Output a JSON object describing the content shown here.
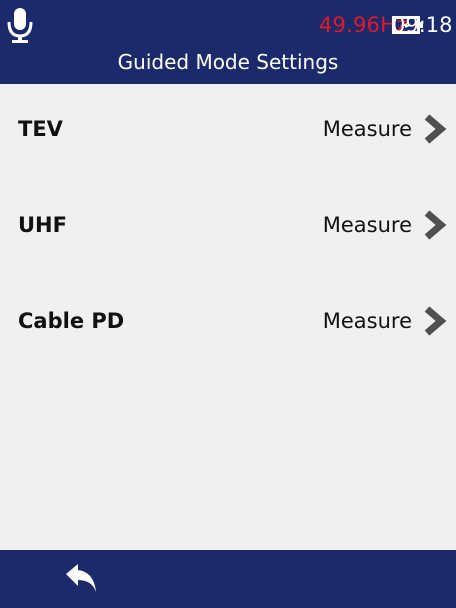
{
  "header": {
    "mic_icon": "microphone-icon",
    "frequency": "49.96Hz",
    "frequency_color": "#e0192a",
    "battery_icon": "battery-charging-icon",
    "time": "09:18",
    "title": "Guided Mode Settings",
    "bar_color": "#1b2a6b"
  },
  "settings": [
    {
      "label": "TEV",
      "value": "Measure",
      "icon": "chevron-right-icon"
    },
    {
      "label": "UHF",
      "value": "Measure",
      "icon": "chevron-right-icon"
    },
    {
      "label": "Cable PD",
      "value": "Measure",
      "icon": "chevron-right-icon"
    }
  ],
  "footer": {
    "back_icon": "back-arrow-icon"
  }
}
